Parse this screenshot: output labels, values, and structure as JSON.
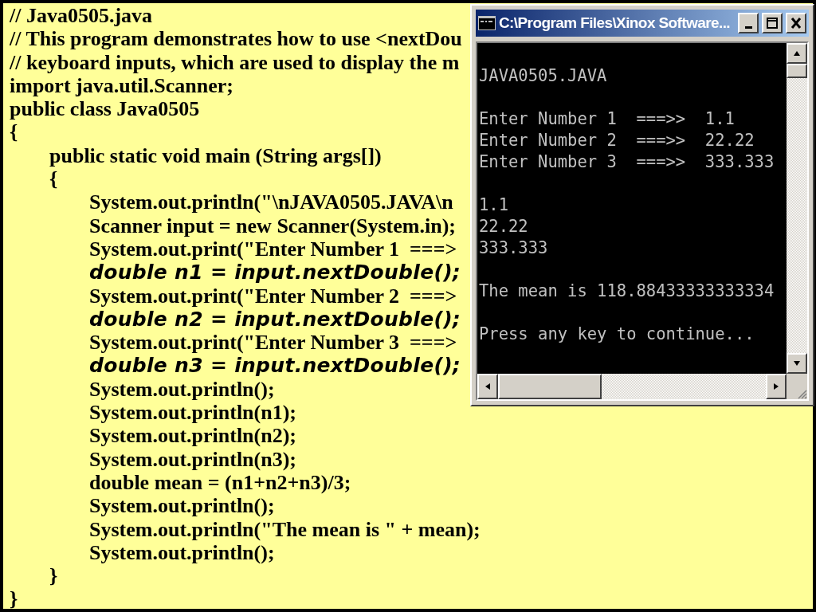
{
  "code_lines": [
    {
      "text": "// Java0505.java",
      "kind": "code"
    },
    {
      "text": "// This program demonstrates how to use <nextDou",
      "kind": "code"
    },
    {
      "text": "// keyboard inputs, which are used to display the m",
      "kind": "code"
    },
    {
      "text": "import java.util.Scanner;",
      "kind": "code"
    },
    {
      "text": "public class Java0505",
      "kind": "code"
    },
    {
      "text": "{",
      "kind": "code",
      "children": [
        {
          "text": "public static void main (String args[])",
          "kind": "code"
        },
        {
          "text": "{",
          "kind": "code",
          "children": [
            {
              "text": "System.out.println(\"\\nJAVA0505.JAVA\\n",
              "kind": "code"
            },
            {
              "text": "Scanner input = new Scanner(System.in);",
              "kind": "code"
            },
            {
              "text": "System.out.print(\"Enter Number 1  ===>",
              "kind": "code"
            },
            {
              "text": "double n1 = input.nextDouble();",
              "kind": "emphasis"
            },
            {
              "text": "System.out.print(\"Enter Number 2  ===>",
              "kind": "code"
            },
            {
              "text": "double n2 = input.nextDouble();",
              "kind": "emphasis"
            },
            {
              "text": "System.out.print(\"Enter Number 3  ===>",
              "kind": "code"
            },
            {
              "text": "double n3 = input.nextDouble();",
              "kind": "emphasis"
            },
            {
              "text": "System.out.println();",
              "kind": "code"
            },
            {
              "text": "System.out.println(n1);",
              "kind": "code"
            },
            {
              "text": "System.out.println(n2);",
              "kind": "code"
            },
            {
              "text": "System.out.println(n3);",
              "kind": "code"
            },
            {
              "text": "double mean = (n1+n2+n3)/3;",
              "kind": "code"
            },
            {
              "text": "System.out.println();",
              "kind": "code"
            },
            {
              "text": "System.out.println(\"The mean is \" + mean);",
              "kind": "code"
            },
            {
              "text": "System.out.println();",
              "kind": "code"
            }
          ]
        },
        {
          "text": "}",
          "kind": "code"
        }
      ]
    },
    {
      "text": "}",
      "kind": "code"
    }
  ],
  "console_window": {
    "title": "C:\\Program Files\\Xinox Software...",
    "output_blocks": [
      [
        "JAVA0505.JAVA"
      ],
      [
        "Enter Number 1  ===>>  1.1",
        "Enter Number 2  ===>>  22.22",
        "Enter Number 3  ===>>  333.333"
      ],
      [
        "1.1",
        "22.22",
        "333.333"
      ],
      [
        "The mean is 118.88433333333334"
      ],
      [
        "Press any key to continue..."
      ]
    ]
  }
}
